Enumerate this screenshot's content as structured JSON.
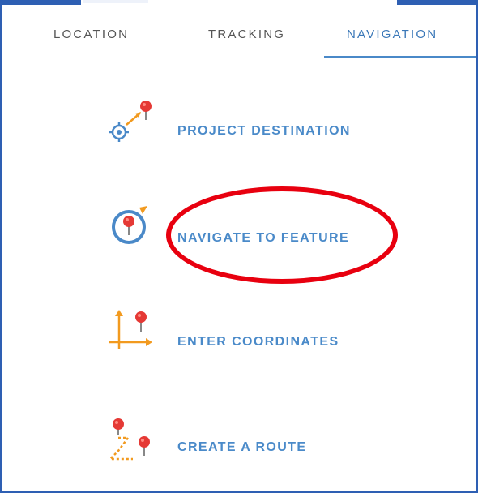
{
  "tabs": [
    {
      "label": "LOCATION"
    },
    {
      "label": "TRACKING"
    },
    {
      "label": "NAVIGATION",
      "active": true
    }
  ],
  "menu": {
    "items": [
      {
        "label": "PROJECT DESTINATION",
        "icon": "project-destination-icon"
      },
      {
        "label": "NAVIGATE TO FEATURE",
        "icon": "navigate-to-feature-icon"
      },
      {
        "label": "ENTER COORDINATES",
        "icon": "enter-coordinates-icon"
      },
      {
        "label": "CREATE A ROUTE",
        "icon": "create-route-icon"
      }
    ]
  },
  "colors": {
    "accent": "#4a8ac9",
    "pin": "#e53935",
    "orange": "#f29a1f",
    "frame": "#2e5fb3",
    "highlight": "#e8000f"
  }
}
